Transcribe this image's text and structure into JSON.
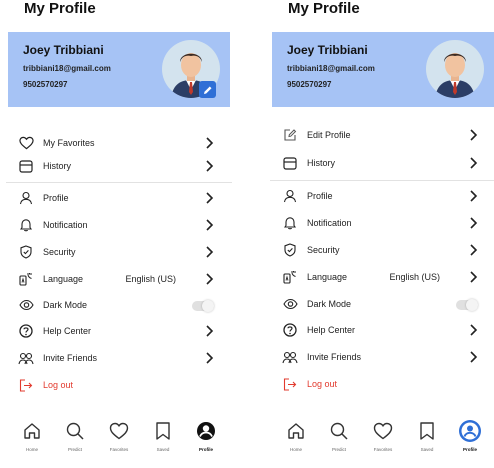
{
  "title": "My Profile",
  "user": {
    "name": "Joey Tribbiani",
    "email": "tribbiani18@gmail.com",
    "phone": "9502570297"
  },
  "left_menu_top": [
    {
      "label": "My Favorites",
      "icon": "heart-icon"
    },
    {
      "label": "History",
      "icon": "history-icon"
    }
  ],
  "right_menu_top": [
    {
      "label": "Edit Profile",
      "icon": "edit-profile-icon"
    },
    {
      "label": "History",
      "icon": "history-icon"
    }
  ],
  "menu": [
    {
      "label": "Profile",
      "icon": "user-icon"
    },
    {
      "label": "Notification",
      "icon": "bell-icon"
    },
    {
      "label": "Security",
      "icon": "shield-icon"
    },
    {
      "label": "Language",
      "icon": "language-icon",
      "value": "English (US)"
    },
    {
      "label": "Dark Mode",
      "icon": "eye-icon"
    },
    {
      "label": "Help Center",
      "icon": "help-icon"
    },
    {
      "label": "Invite Friends",
      "icon": "people-icon"
    },
    {
      "label": "Log out",
      "icon": "logout-icon"
    }
  ],
  "tabs": [
    {
      "label": "Home",
      "icon": "home-icon"
    },
    {
      "label": "Predict",
      "icon": "search-icon"
    },
    {
      "label": "Favorites",
      "icon": "heart-icon"
    },
    {
      "label": "Saved",
      "icon": "bookmark-icon"
    },
    {
      "label": "Profile",
      "icon": "profile-icon"
    }
  ],
  "colors": {
    "card_bg": "#a6c3f5",
    "accent": "#2f6fd6",
    "logout": "#e23a2e"
  }
}
